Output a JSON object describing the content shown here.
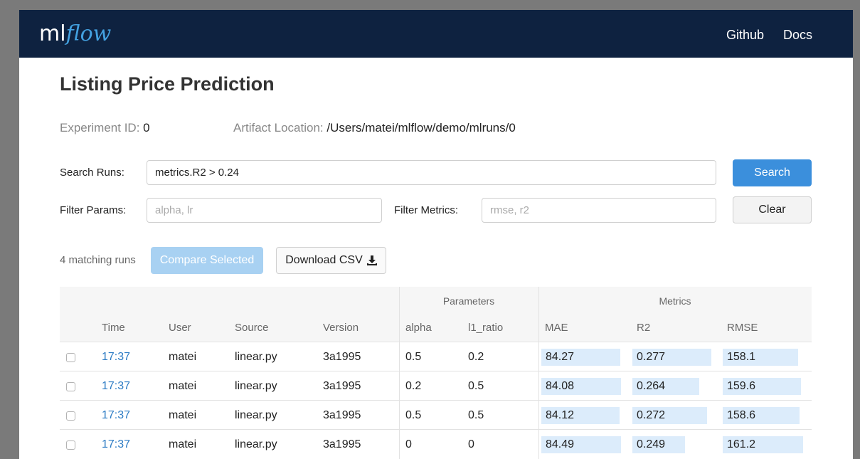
{
  "navbar": {
    "logo_ml": "ml",
    "logo_flow": "flow",
    "links": [
      "Github",
      "Docs"
    ]
  },
  "page_title": "Listing Price Prediction",
  "experiment": {
    "id_label": "Experiment ID:",
    "id_value": "0",
    "artifact_label": "Artifact Location:",
    "artifact_value": "/Users/matei/mlflow/demo/mlruns/0"
  },
  "search": {
    "label": "Search Runs:",
    "value": "metrics.R2 > 0.24",
    "button": "Search"
  },
  "filters": {
    "params_label": "Filter Params:",
    "params_placeholder": "alpha, lr",
    "metrics_label": "Filter Metrics:",
    "metrics_placeholder": "rmse, r2",
    "clear_button": "Clear"
  },
  "actions": {
    "match_count": "4 matching runs",
    "compare_button": "Compare Selected",
    "download_button": "Download CSV"
  },
  "table": {
    "group_headers": {
      "parameters": "Parameters",
      "metrics": "Metrics"
    },
    "headers": {
      "time": "Time",
      "user": "User",
      "source": "Source",
      "version": "Version",
      "alpha": "alpha",
      "l1_ratio": "l1_ratio",
      "mae": "MAE",
      "r2": "R2",
      "rmse": "RMSE"
    },
    "rows": [
      {
        "time": "17:37",
        "user": "matei",
        "source": "linear.py",
        "version": "3a1995",
        "alpha": "0.5",
        "l1_ratio": "0.2",
        "mae": "84.27",
        "r2": "0.277",
        "rmse": "158.1"
      },
      {
        "time": "17:37",
        "user": "matei",
        "source": "linear.py",
        "version": "3a1995",
        "alpha": "0.2",
        "l1_ratio": "0.5",
        "mae": "84.08",
        "r2": "0.264",
        "rmse": "159.6"
      },
      {
        "time": "17:37",
        "user": "matei",
        "source": "linear.py",
        "version": "3a1995",
        "alpha": "0.5",
        "l1_ratio": "0.5",
        "mae": "84.12",
        "r2": "0.272",
        "rmse": "158.6"
      },
      {
        "time": "17:37",
        "user": "matei",
        "source": "linear.py",
        "version": "3a1995",
        "alpha": "0",
        "l1_ratio": "0",
        "mae": "84.49",
        "r2": "0.249",
        "rmse": "161.2"
      }
    ]
  },
  "colors": {
    "navbar_bg": "#0e2240",
    "accent": "#3b8fdc",
    "link": "#2c7bc4",
    "metric_bar": "#dcecfb"
  }
}
